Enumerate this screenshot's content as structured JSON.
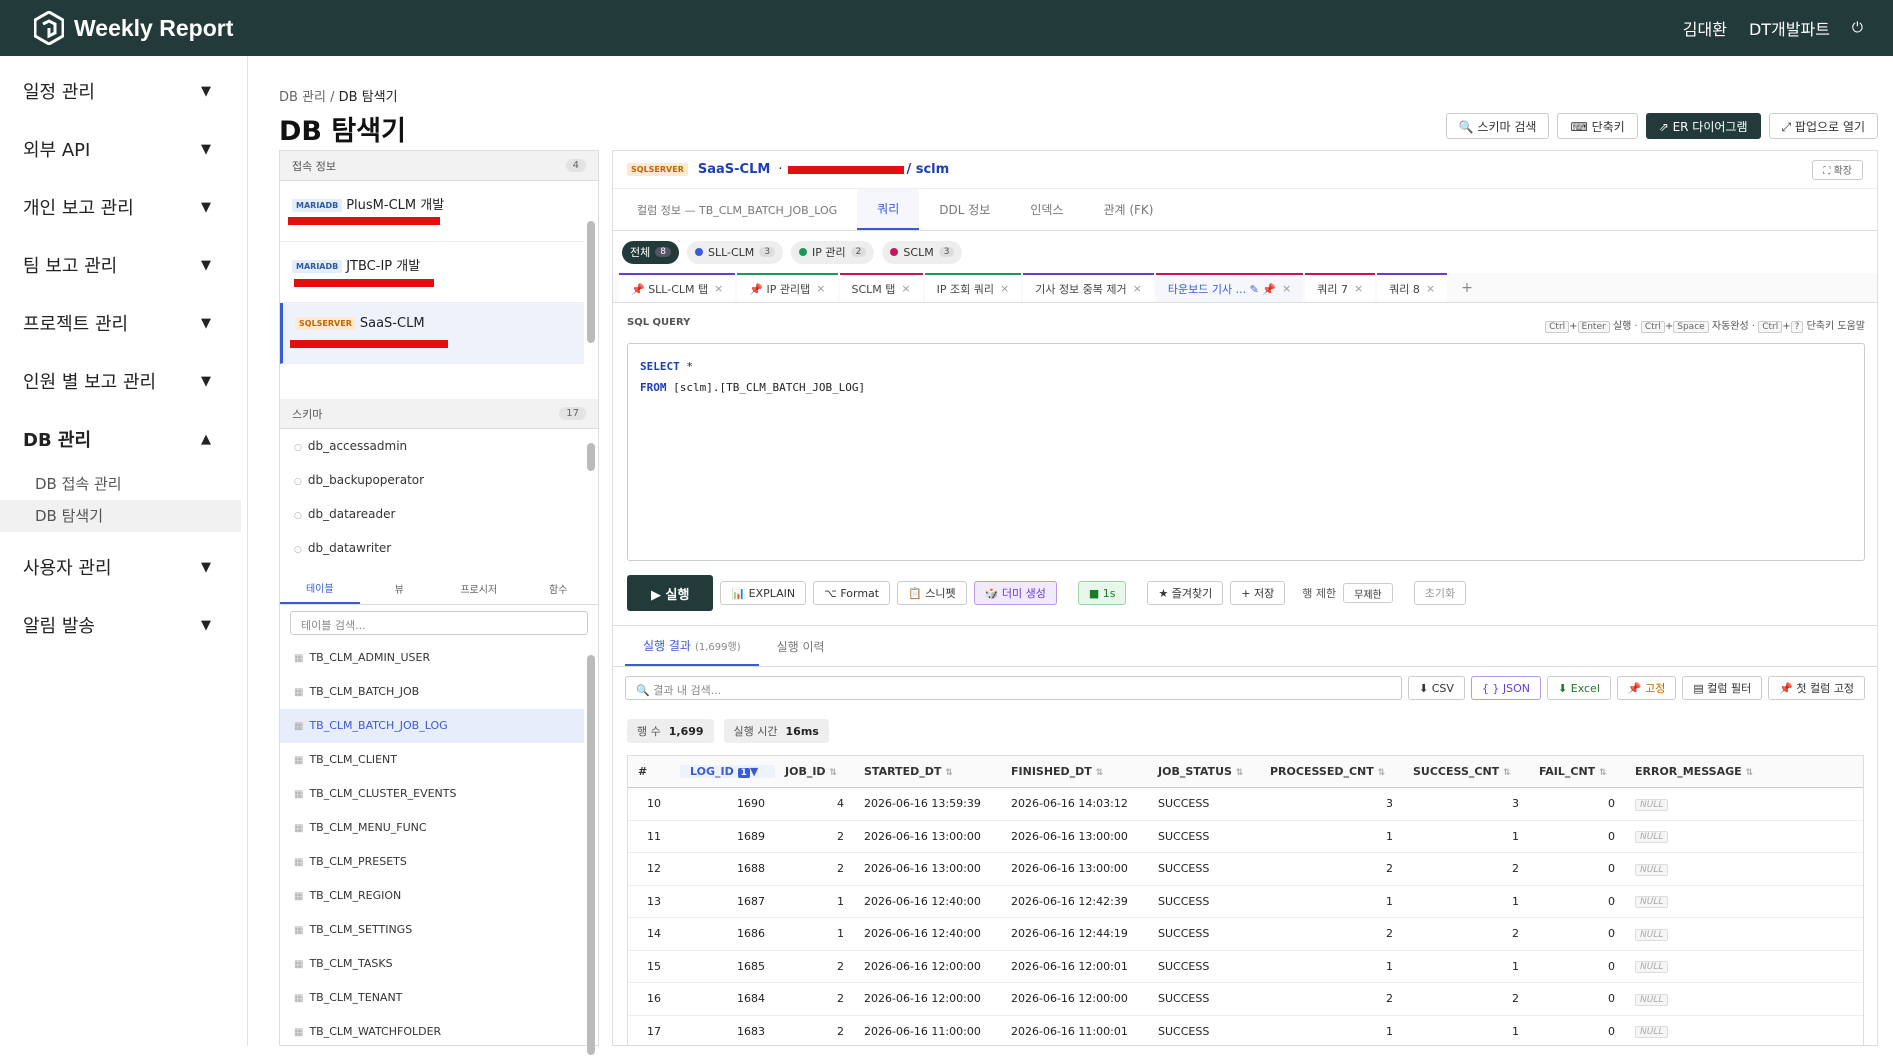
{
  "header": {
    "title": "Weekly Report",
    "user": "김대환",
    "team": "DT개발파트"
  },
  "sidebar": {
    "items": [
      {
        "label": "일정 관리"
      },
      {
        "label": "외부 API"
      },
      {
        "label": "개인 보고 관리"
      },
      {
        "label": "팀 보고 관리"
      },
      {
        "label": "프로젝트 관리"
      },
      {
        "label": "인원 별 보고 관리"
      },
      {
        "label": "DB 관리"
      },
      {
        "label": "사용자 관리"
      },
      {
        "label": "알림 발송"
      }
    ],
    "sub": [
      "DB 접속 관리",
      "DB 탐색기"
    ]
  },
  "page": {
    "crumb_root": "DB 관리 /",
    "crumb_leaf": "DB 탐색기",
    "title": "DB 탐색기"
  },
  "top_buttons": [
    "🔍 스키마 검색",
    "⌨ 단축키",
    "⇗ ER 다이어그램",
    "⤢ 팝업으로 열기"
  ],
  "left": {
    "conn_title": "접속 정보",
    "conn_count": "4",
    "connections": [
      {
        "type": "MARIADB",
        "name": "PlusM-CLM 개발"
      },
      {
        "type": "MARIADB",
        "name": "JTBC-IP 개발"
      },
      {
        "type": "SQLSERVER",
        "name": "SaaS-CLM"
      }
    ],
    "schema_title": "스키마",
    "schema_count": "17",
    "schemas": [
      "db_accessadmin",
      "db_backupoperator",
      "db_datareader",
      "db_datawriter"
    ],
    "obj_tabs": [
      "테이블",
      "뷰",
      "프로시저",
      "함수"
    ],
    "table_search_ph": "테이블 검색...",
    "tables": [
      "TB_CLM_ADMIN_USER",
      "TB_CLM_BATCH_JOB",
      "TB_CLM_BATCH_JOB_LOG",
      "TB_CLM_CLIENT",
      "TB_CLM_CLUSTER_EVENTS",
      "TB_CLM_MENU_FUNC",
      "TB_CLM_PRESETS",
      "TB_CLM_REGION",
      "TB_CLM_SETTINGS",
      "TB_CLM_TASKS",
      "TB_CLM_TENANT",
      "TB_CLM_WATCHFOLDER"
    ]
  },
  "right": {
    "db_type": "SQLSERVER",
    "conn_name": "SaaS-CLM",
    "sep": "·",
    "schema": "/ sclm",
    "expand": "⛶ 확장",
    "tabs": [
      "컬럼 정보 — TB_CLM_BATCH_JOB_LOG",
      "쿼리",
      "DDL 정보",
      "인덱스",
      "관계 (FK)"
    ],
    "chips": [
      {
        "label": "전체",
        "n": "8",
        "color": ""
      },
      {
        "label": "SLL-CLM",
        "n": "3",
        "color": "#3a5bd6"
      },
      {
        "label": "IP 관리",
        "n": "2",
        "color": "#1a9a5a"
      },
      {
        "label": "SCLM",
        "n": "3",
        "color": "#c2185b"
      }
    ],
    "query_tabs": [
      "📌 SLL-CLM 탭",
      "📌 IP 관리탭",
      "SCLM 탭",
      "IP 조회 쿼리",
      "기사 정보 중복 제거",
      "타운보드 기사 ... ✎ 📌",
      "쿼리 7",
      "쿼리 8"
    ],
    "sql_label": "SQL QUERY",
    "shortcut": [
      "Ctrl",
      "Enter",
      "실행",
      "Ctrl",
      "Space",
      "자동완성",
      "Ctrl",
      "?",
      "단축키 도움말"
    ],
    "sql_kw1": "SELECT",
    "sql_l1": " *",
    "sql_kw2": "FROM",
    "sql_l2": " [sclm].[TB_CLM_BATCH_JOB_LOG]",
    "run": "▶ 실행",
    "tool": [
      "📊 EXPLAIN",
      "⌥ Format",
      "📋 스니펫",
      "🎲 더미 생성",
      "■ 1s",
      "★ 즐겨찾기",
      "+ 저장"
    ],
    "limit_label": "행 제한",
    "limit_value": "무제한",
    "reset": "초기화",
    "res_tabs": [
      "실행 결과",
      "(1,699행)",
      "실행 이력"
    ],
    "res_search_ph": "🔍 결과 내 검색...",
    "res_btns": [
      "⬇ CSV",
      "{ } JSON",
      "⬇ Excel",
      "📌 고정",
      "▤ 컬럼 필터",
      "📌 첫 컬럼 고정"
    ],
    "rows_label": "행 수",
    "rows_value": "1,699",
    "time_label": "실행 시간",
    "time_value": "16ms",
    "columns": [
      "#",
      "LOG_ID",
      "JOB_ID",
      "STARTED_DT",
      "FINISHED_DT",
      "JOB_STATUS",
      "PROCESSED_CNT",
      "SUCCESS_CNT",
      "FAIL_CNT",
      "ERROR_MESSAGE"
    ],
    "sort_badge": "1",
    "rows": [
      [
        "10",
        "1690",
        "4",
        "2026-06-16 13:59:39",
        "2026-06-16 14:03:12",
        "SUCCESS",
        "3",
        "3",
        "0",
        "NULL"
      ],
      [
        "11",
        "1689",
        "2",
        "2026-06-16 13:00:00",
        "2026-06-16 13:00:00",
        "SUCCESS",
        "1",
        "1",
        "0",
        "NULL"
      ],
      [
        "12",
        "1688",
        "2",
        "2026-06-16 13:00:00",
        "2026-06-16 13:00:00",
        "SUCCESS",
        "2",
        "2",
        "0",
        "NULL"
      ],
      [
        "13",
        "1687",
        "1",
        "2026-06-16 12:40:00",
        "2026-06-16 12:42:39",
        "SUCCESS",
        "1",
        "1",
        "0",
        "NULL"
      ],
      [
        "14",
        "1686",
        "1",
        "2026-06-16 12:40:00",
        "2026-06-16 12:44:19",
        "SUCCESS",
        "2",
        "2",
        "0",
        "NULL"
      ],
      [
        "15",
        "1685",
        "2",
        "2026-06-16 12:00:00",
        "2026-06-16 12:00:01",
        "SUCCESS",
        "1",
        "1",
        "0",
        "NULL"
      ],
      [
        "16",
        "1684",
        "2",
        "2026-06-16 12:00:00",
        "2026-06-16 12:00:00",
        "SUCCESS",
        "2",
        "2",
        "0",
        "NULL"
      ],
      [
        "17",
        "1683",
        "2",
        "2026-06-16 11:00:00",
        "2026-06-16 11:00:01",
        "SUCCESS",
        "1",
        "1",
        "0",
        "NULL"
      ]
    ]
  }
}
